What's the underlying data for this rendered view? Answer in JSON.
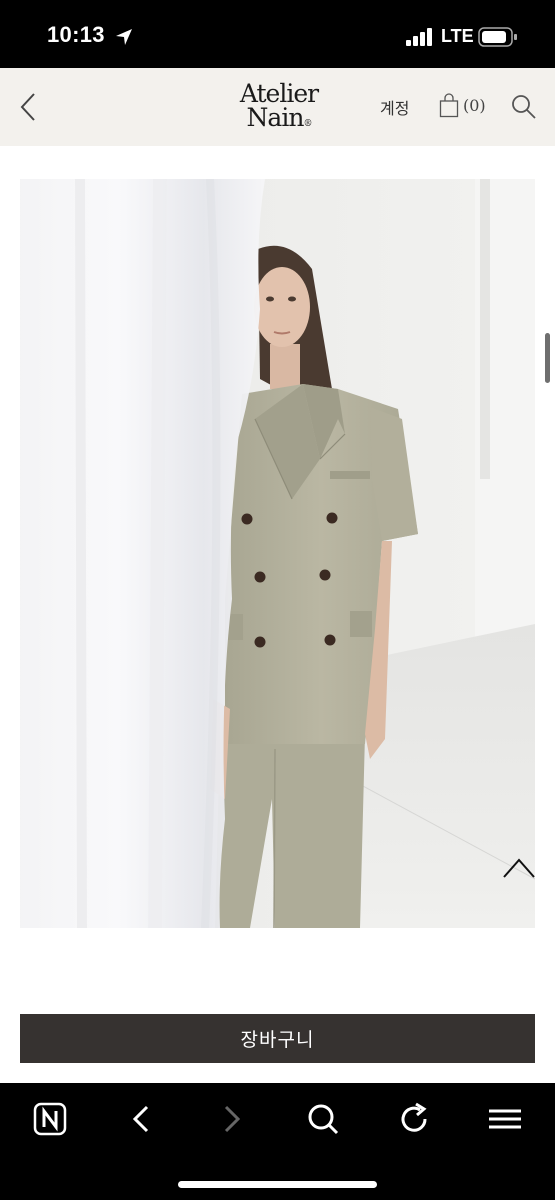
{
  "status_bar": {
    "time": "10:13",
    "network": "LTE",
    "icons": [
      "location-arrow-icon",
      "signal-icon",
      "battery-icon"
    ]
  },
  "header": {
    "logo_line1": "Atelier",
    "logo_line2": "Nain",
    "logo_mark": "®",
    "account_label": "계정",
    "cart_count": "(0)",
    "icons": [
      "back-icon",
      "shopping-bag-icon",
      "search-icon"
    ]
  },
  "product": {
    "image_subject": "model in beige double-breasted short-sleeve blazer and trousers behind white curtain",
    "scroll_top_icon": "chevron-up-icon"
  },
  "actions": {
    "add_to_cart_label": "장바구니"
  },
  "browser_toolbar": {
    "items": [
      "naver-home-icon",
      "back-icon",
      "forward-icon",
      "search-icon",
      "reload-icon",
      "menu-icon"
    ]
  },
  "colors": {
    "header_bg": "#f3f1ed",
    "button_bg": "#363230",
    "suit_color": "#b6b39f"
  }
}
